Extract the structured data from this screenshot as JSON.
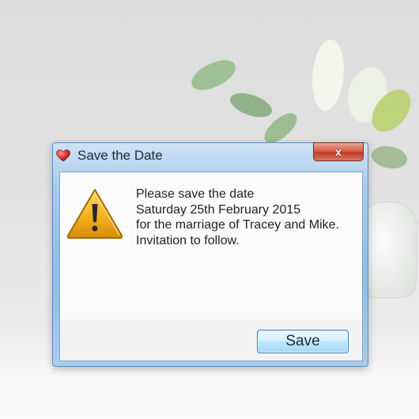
{
  "window": {
    "title": "Save the Date",
    "close_label": "x"
  },
  "message": {
    "lines": [
      "Please save the date",
      "Saturday 25th February 2015",
      "for the marriage of Tracey and Mike.",
      "Invitation to follow."
    ]
  },
  "buttons": {
    "save_label": "Save"
  },
  "icons": {
    "title_icon": "heart-icon",
    "message_icon": "warning-icon"
  },
  "colors": {
    "title_bar": "#a7cbea",
    "close_button": "#c13b26",
    "save_button": "#bee6fd",
    "warning_icon": "#f2b21e",
    "heart": "#d8322c"
  }
}
